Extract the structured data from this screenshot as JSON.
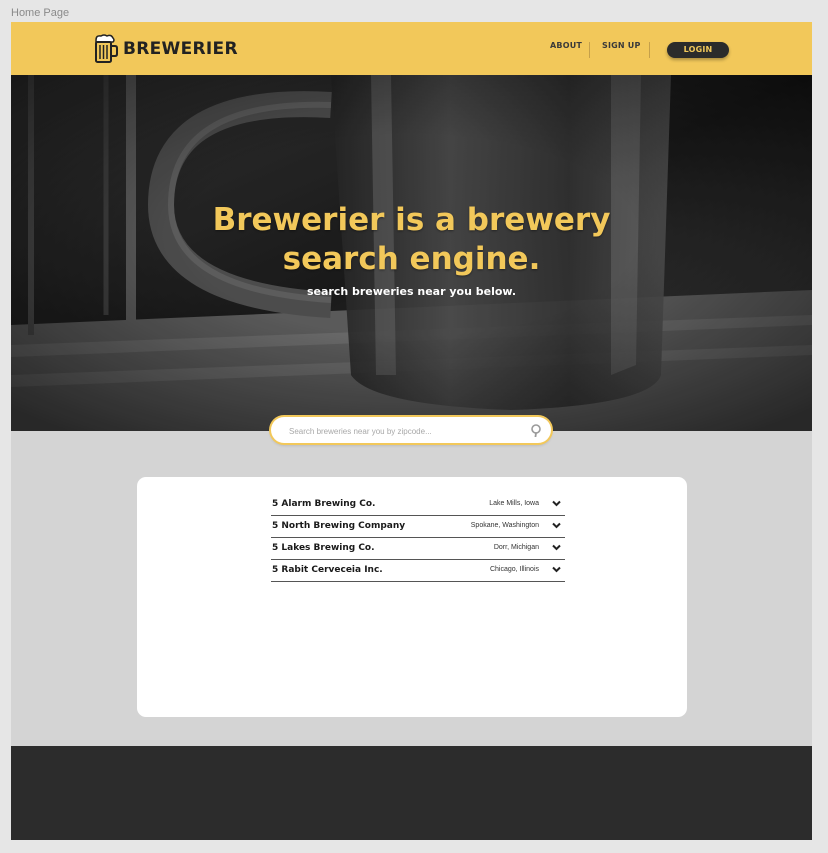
{
  "artboard": {
    "label": "Home Page"
  },
  "header": {
    "brand": "BREWERIER",
    "nav": {
      "about": "ABOUT",
      "signup": "SIGN UP"
    },
    "login": "LOGIN",
    "accent_color": "#f2c85a"
  },
  "hero": {
    "title_line1": "Brewerier is a brewery",
    "title_line2": "search engine.",
    "subtitle": "search breweries near you below."
  },
  "search": {
    "placeholder": "Search breweries near you by zipcode...",
    "icon": "search-icon"
  },
  "results": [
    {
      "name": "5 Alarm Brewing Co.",
      "location": "Lake Mills, Iowa"
    },
    {
      "name": "5 North Brewing Company",
      "location": "Spokane, Washington"
    },
    {
      "name": "5 Lakes Brewing Co.",
      "location": "Dorr, Michigan"
    },
    {
      "name": "5 Rabit Cerveceia Inc.",
      "location": "Chicago, Illinois"
    }
  ]
}
